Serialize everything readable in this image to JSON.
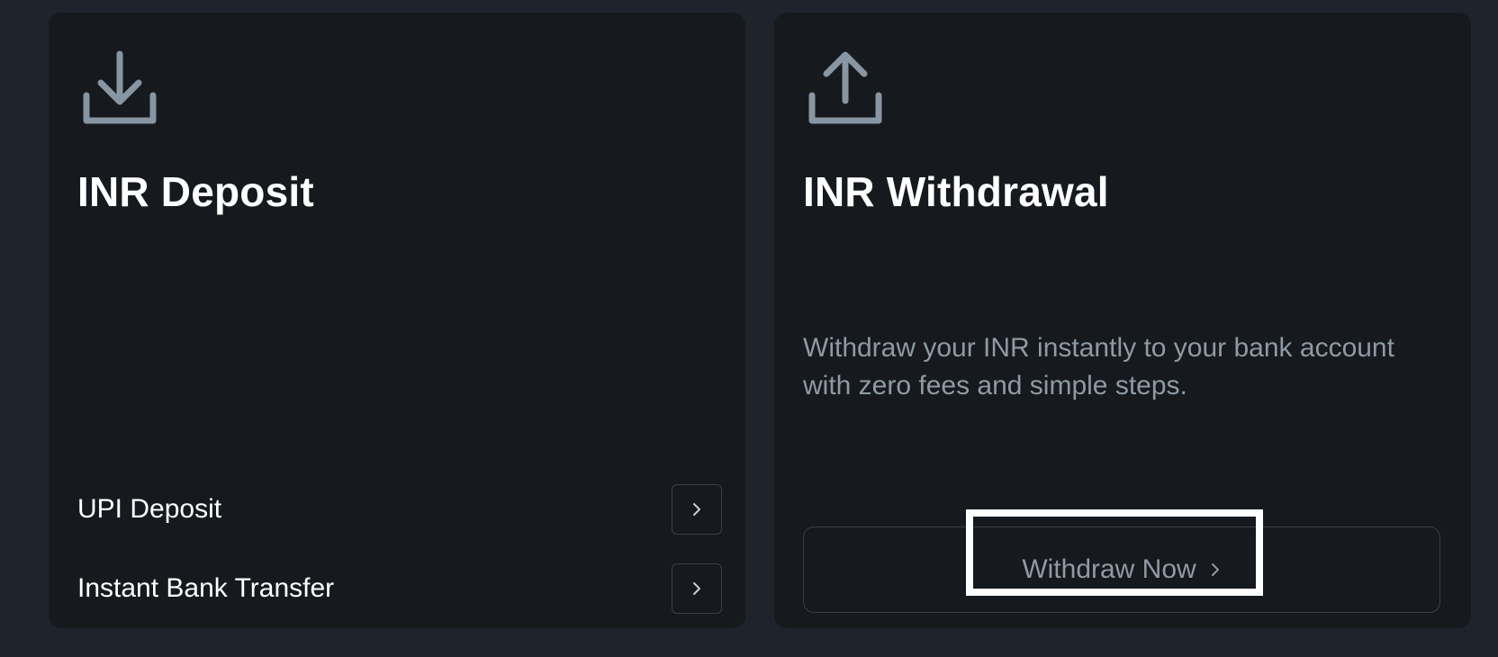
{
  "deposit_card": {
    "icon": "download-icon",
    "title": "INR Deposit",
    "options": [
      {
        "label": "UPI Deposit",
        "icon": "chevron-right-icon"
      },
      {
        "label": "Instant Bank Transfer",
        "icon": "chevron-right-icon"
      }
    ]
  },
  "withdraw_card": {
    "icon": "upload-icon",
    "title": "INR Withdrawal",
    "description": "Withdraw your INR instantly to your bank account with zero fees and simple steps.",
    "button_label": "Withdraw Now",
    "button_icon": "chevron-right-icon"
  },
  "colors": {
    "page_bg": "#1f232b",
    "card_bg": "#16191d",
    "title": "#ffffff",
    "muted_text": "#8f9aa5",
    "icon": "#8895a2",
    "border": "#3b4047",
    "highlight": "#ffffff"
  }
}
